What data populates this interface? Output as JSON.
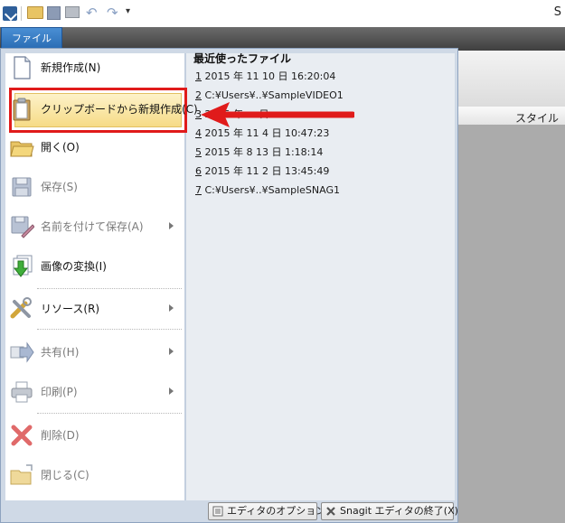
{
  "titlebar": {
    "title_fragment": "S",
    "more_glyph": "▾"
  },
  "ribbon": {
    "file_tab": "ファイル",
    "column_header": "スタイル"
  },
  "file_menu": {
    "items": [
      {
        "label": "新規作成(N)",
        "icon": "new-document-icon",
        "has_submenu": false,
        "enabled": true
      },
      {
        "label": "クリップボードから新規作成(C)",
        "icon": "clipboard-icon",
        "has_submenu": false,
        "enabled": true,
        "highlighted": true
      },
      {
        "label": "開く(O)",
        "icon": "folder-open-icon",
        "has_submenu": false,
        "enabled": true
      },
      {
        "label": "保存(S)",
        "icon": "save-icon",
        "has_submenu": false,
        "enabled": false
      },
      {
        "label": "名前を付けて保存(A)",
        "icon": "save-as-icon",
        "has_submenu": true,
        "enabled": false
      },
      {
        "label": "画像の変換(I)",
        "icon": "convert-image-icon",
        "has_submenu": false,
        "enabled": true
      },
      {
        "label": "リソース(R)",
        "icon": "resources-tools-icon",
        "has_submenu": true,
        "enabled": true
      },
      {
        "label": "共有(H)",
        "icon": "share-arrow-icon",
        "has_submenu": true,
        "enabled": false
      },
      {
        "label": "印刷(P)",
        "icon": "printer-icon",
        "has_submenu": true,
        "enabled": false
      },
      {
        "label": "削除(D)",
        "icon": "delete-x-icon",
        "has_submenu": false,
        "enabled": false
      },
      {
        "label": "閉じる(C)",
        "icon": "close-folder-icon",
        "has_submenu": false,
        "enabled": false
      }
    ]
  },
  "recent_files": {
    "title": "最近使ったファイル",
    "items": [
      {
        "num": "1",
        "text": " 2015 年 11 10 日  16:20:04"
      },
      {
        "num": "2",
        "text": " C:¥Users¥..¥SampleVIDEO1"
      },
      {
        "num": "3",
        "text": " 2015 年 ... 日"
      },
      {
        "num": "4",
        "text": " 2015 年 11 4 日  10:47:23"
      },
      {
        "num": "5",
        "text": " 2015 年 8 13 日  1:18:14"
      },
      {
        "num": "6",
        "text": " 2015 年 11 2 日  13:45:49"
      },
      {
        "num": "7",
        "text": " C:¥Users¥..¥SampleSNAG1"
      }
    ]
  },
  "bottom_buttons": {
    "options": "エディタのオプション...",
    "exit": "Snagit エディタの終了(X)"
  },
  "colors": {
    "highlight_border": "#e01b1b",
    "annotation_arrow": "#e01b1b",
    "file_tab": "#2a6cb4"
  }
}
